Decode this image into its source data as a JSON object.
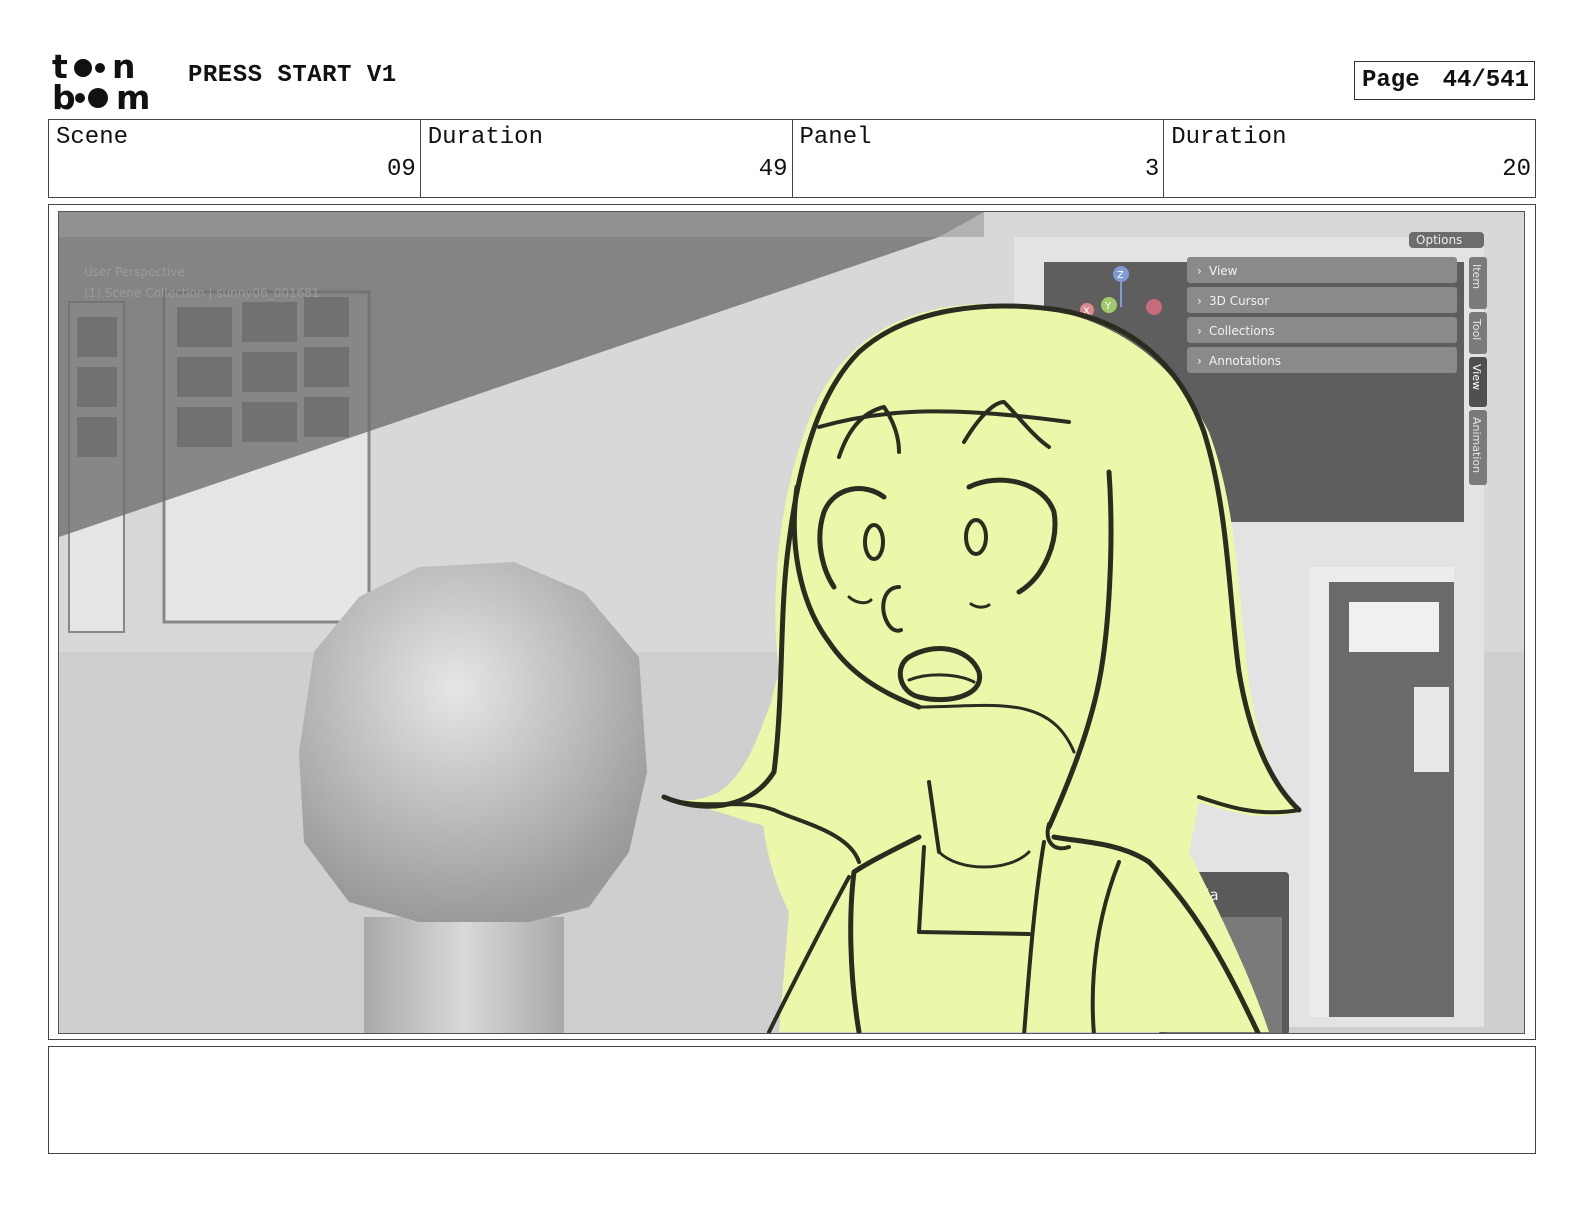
{
  "header": {
    "logo_text": "toon boom",
    "project_title": "PRESS START V1",
    "page_label": "Page",
    "page_number": "44/541"
  },
  "info": {
    "scene_label": "Scene",
    "scene_value": "09",
    "scene_duration_label": "Duration",
    "scene_duration_value": "49",
    "panel_label": "Panel",
    "panel_value": "3",
    "panel_duration_label": "Duration",
    "panel_duration_value": "20"
  },
  "viewport": {
    "overlay_line_1": "User Perspective",
    "overlay_line_2": "(1) Scene Collection | sunny06_001681",
    "options_label": "Options",
    "sidebar_items": [
      "View",
      "3D Cursor",
      "Collections",
      "Annotations"
    ],
    "vertical_tabs": [
      "Item",
      "Tool",
      "View",
      "Animation"
    ],
    "gizmo_axes": [
      "Z",
      "Y",
      "X"
    ],
    "media_label": "média"
  },
  "colors": {
    "sketch_fill": "#ecf7a9",
    "sketch_line": "#2b2b1f",
    "overlay_shade": "#7a7a7a"
  },
  "notes": {
    "text": ""
  }
}
